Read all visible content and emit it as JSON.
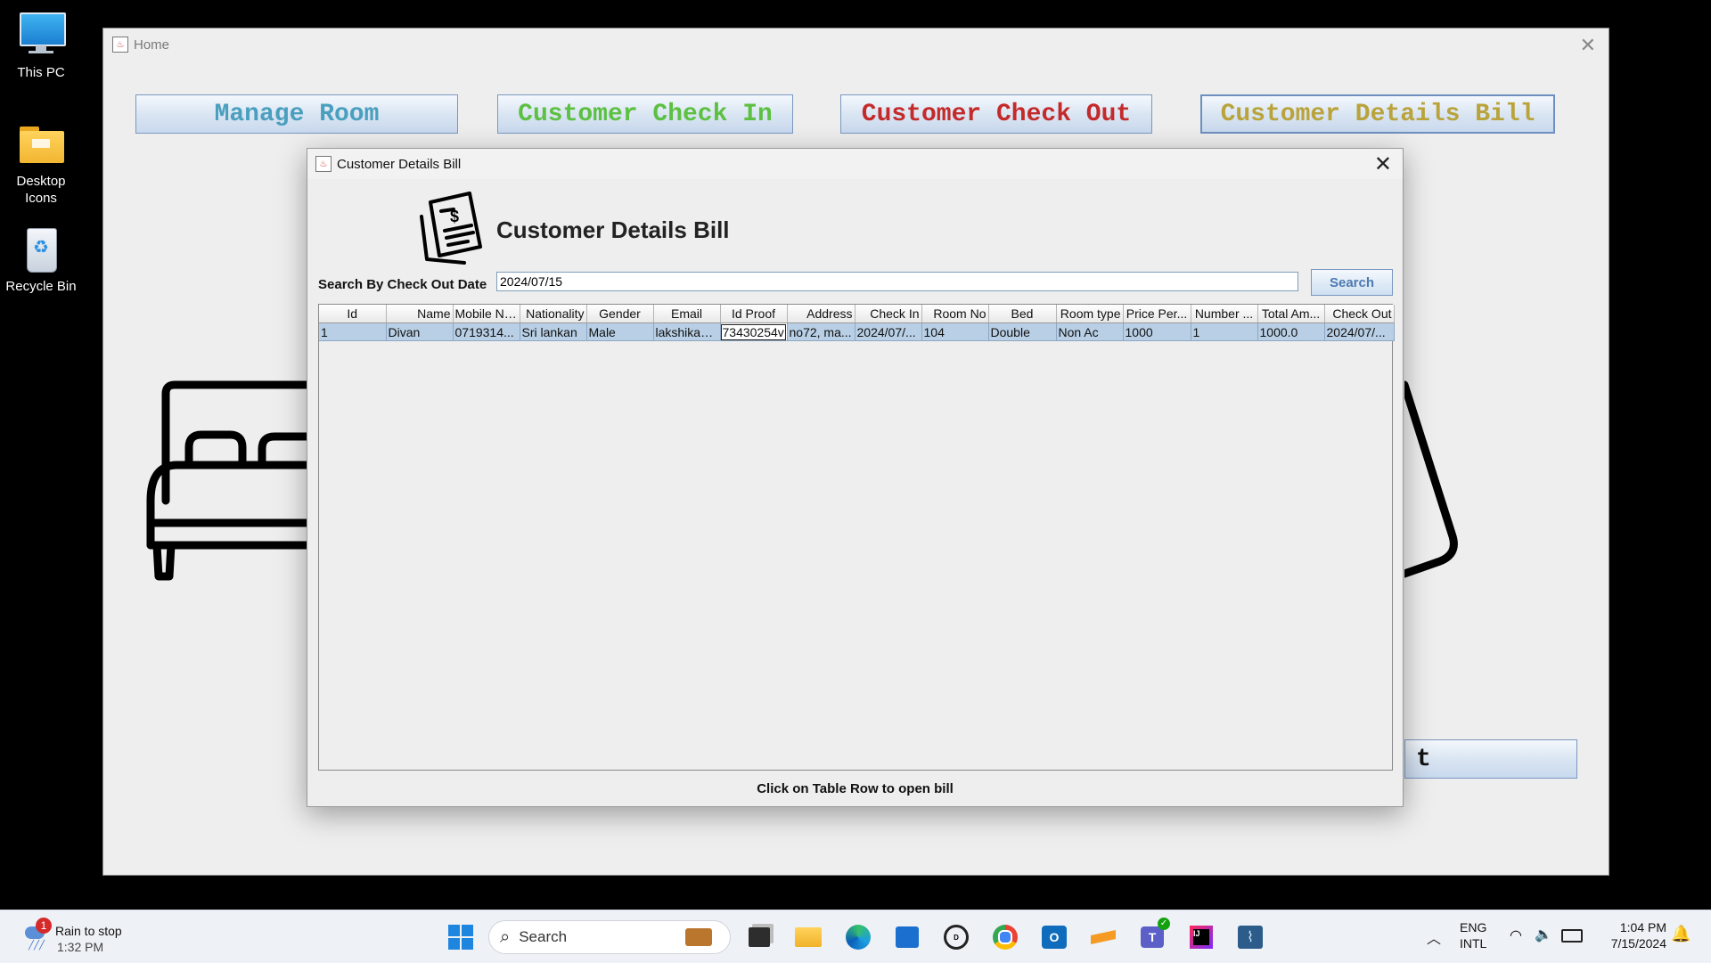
{
  "desktop": {
    "icons": [
      {
        "label": "This PC"
      },
      {
        "label": "Desktop Icons"
      },
      {
        "label": "Recycle Bin"
      }
    ]
  },
  "home": {
    "title": "Home",
    "buttons": [
      {
        "label": "Manage Room",
        "color": "#4a9fbf"
      },
      {
        "label": "Customer Check In",
        "color": "#5cc041"
      },
      {
        "label": "Customer Check Out",
        "color": "#c42a2a"
      },
      {
        "label": "Customer Details Bill",
        "color": "#b9a33a"
      }
    ],
    "partial_button_text": "t"
  },
  "dialog": {
    "title": "Customer Details Bill",
    "heading": "Customer Details Bill",
    "search_label": "Search By Check Out Date",
    "search_value": "2024/07/15",
    "search_button": "Search",
    "columns": [
      "Id",
      "Name",
      "Mobile Nu...",
      "Nationality",
      "Gender",
      "Email",
      "Id Proof",
      "Address",
      "Check In",
      "Room No",
      "Bed",
      "Room type",
      "Price Per...",
      "Number ...",
      "Total Am...",
      "Check Out"
    ],
    "rows": [
      [
        "1",
        "Divan",
        "0719314...",
        "Sri lankan",
        "Male",
        "lakshikad...",
        "73430254v",
        "no72, ma...",
        "2024/07/...",
        "104",
        "Double",
        "Non Ac",
        "1000",
        "1",
        "1000.0",
        "2024/07/..."
      ]
    ],
    "footer": "Click on Table Row to open bill"
  },
  "taskbar": {
    "weather": {
      "badge": "1",
      "text": "Rain to stop",
      "time": "1:32 PM"
    },
    "search_placeholder": "Search",
    "lang": {
      "line1": "ENG",
      "line2": "INTL"
    },
    "clock": {
      "time": "1:04 PM",
      "date": "7/15/2024"
    }
  }
}
